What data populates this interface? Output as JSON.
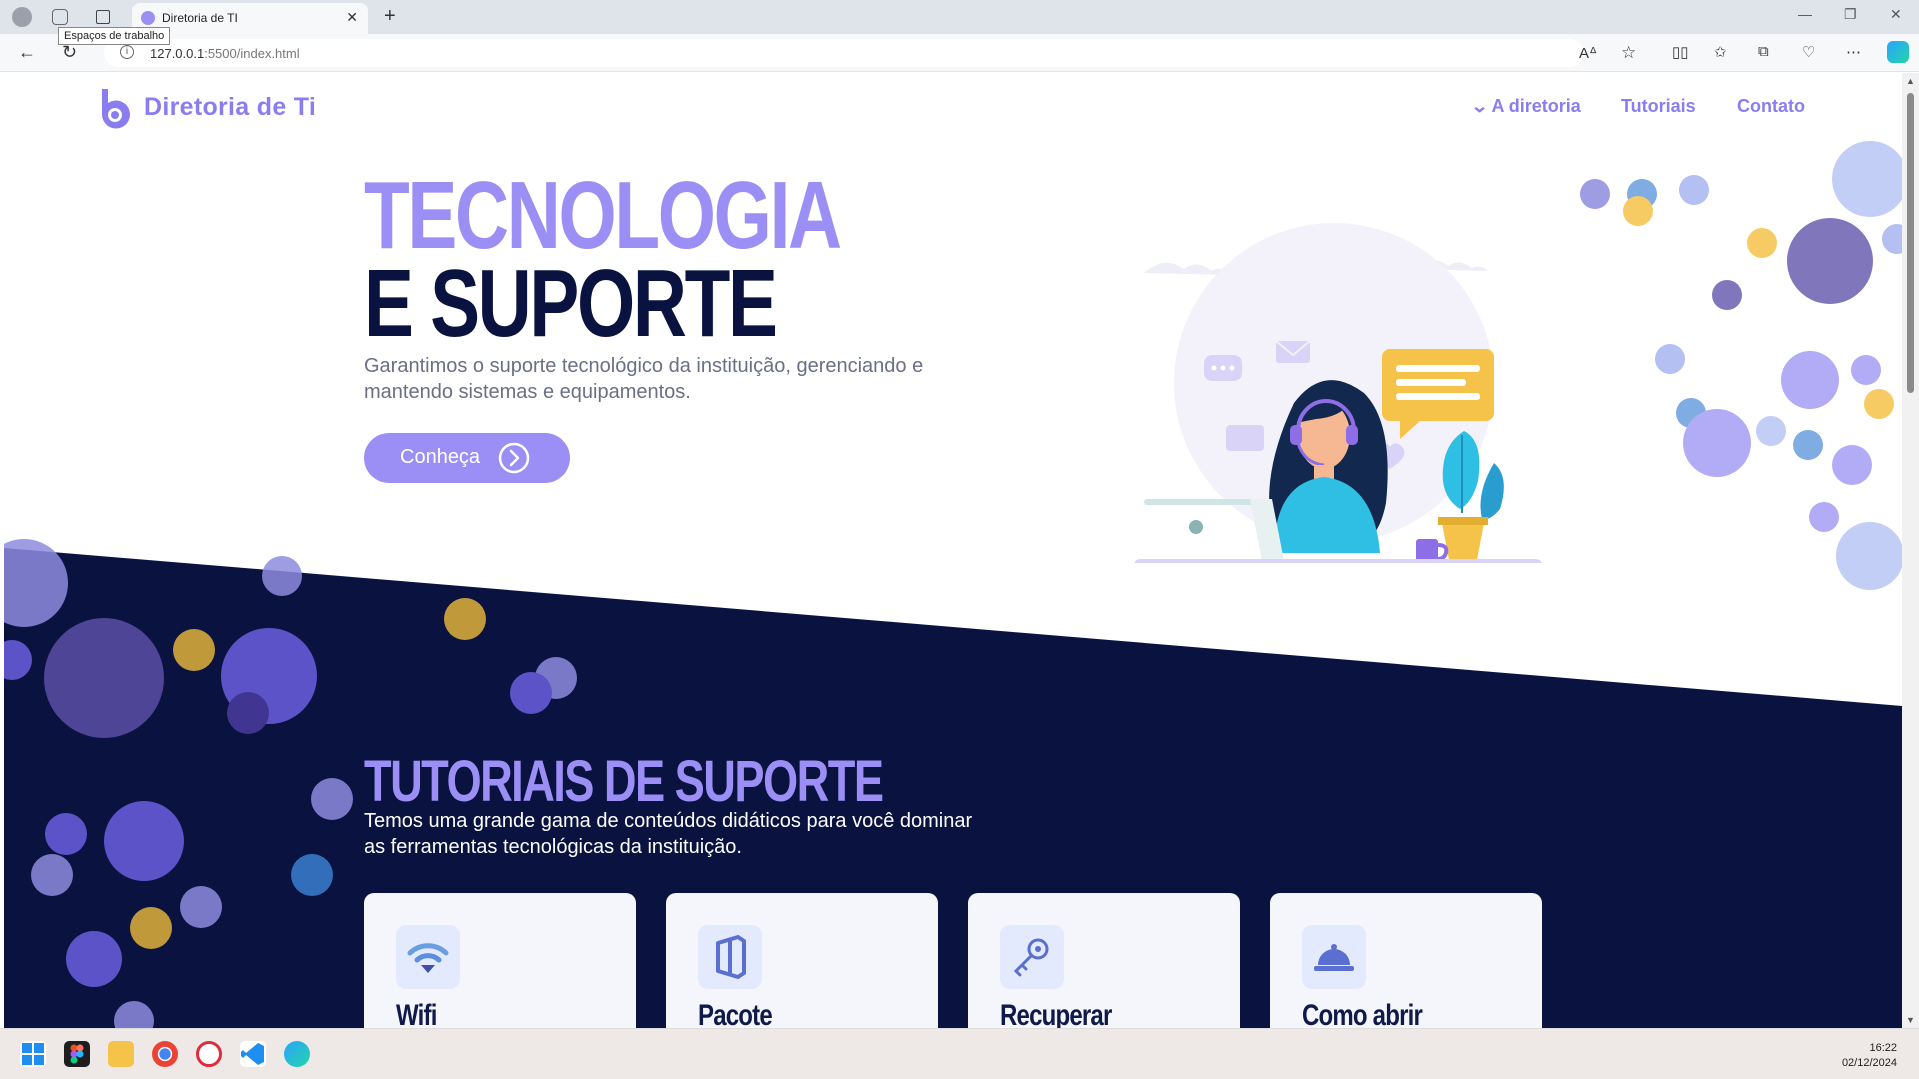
{
  "browser": {
    "tab_title": "Diretoria de TI",
    "tooltip": "Espaços de trabalho",
    "url_host": "127.0.0.1",
    "url_rest": ":5500/index.html"
  },
  "site": {
    "logo_text": "Diretoria de Ti",
    "nav": [
      {
        "label": "A diretoria"
      },
      {
        "label": "Tutoriais"
      },
      {
        "label": "Contato"
      }
    ],
    "hero": {
      "line1": "TECNOLOGIA",
      "line2": "E SUPORTE",
      "subtitle": "Garantimos o suporte tecnológico da instituição, gerenciando e mantendo sistemas e equipamentos.",
      "cta": "Conheça"
    },
    "tutorials": {
      "title": "TUTORIAIS DE SUPORTE",
      "subtitle": "Temos uma grande gama de conteúdos didáticos para você dominar as ferramentas tecnológicas da instituição.",
      "cards": [
        {
          "title": "Wifi",
          "icon": "wifi-icon"
        },
        {
          "title": "Pacote",
          "icon": "office-icon"
        },
        {
          "title": "Recuperar",
          "icon": "key-icon"
        },
        {
          "title": "Como abrir",
          "icon": "service-bell-icon"
        }
      ]
    }
  },
  "taskbar": {
    "time": "16:22",
    "date": "02/12/2024"
  },
  "colors": {
    "accent": "#9b8ff5",
    "navy": "#0a1240",
    "gold": "#f5c24a"
  }
}
